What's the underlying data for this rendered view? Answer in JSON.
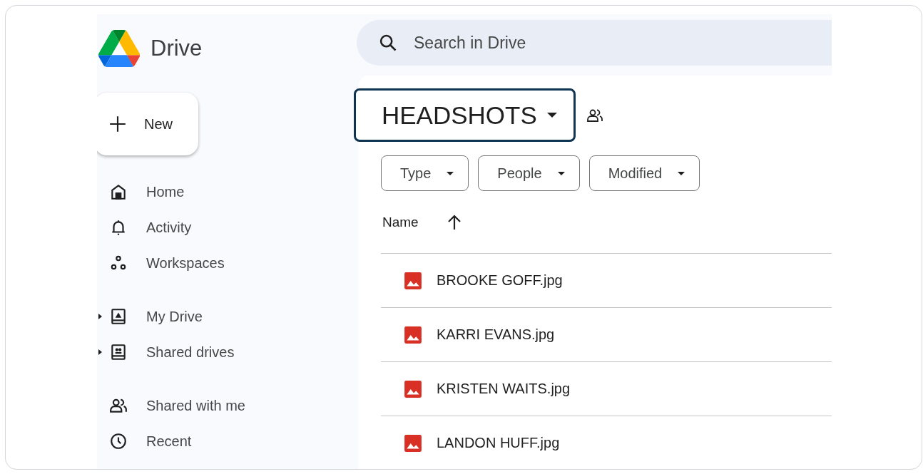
{
  "app": {
    "name": "Drive"
  },
  "search": {
    "placeholder": "Search in Drive"
  },
  "new_button": {
    "label": "New"
  },
  "nav_groups": [
    [
      {
        "label": "Home",
        "kind": "link"
      },
      {
        "label": "Activity",
        "kind": "link"
      },
      {
        "label": "Workspaces",
        "kind": "link"
      }
    ],
    [
      {
        "label": "My Drive",
        "kind": "tree"
      },
      {
        "label": "Shared drives",
        "kind": "tree"
      }
    ],
    [
      {
        "label": "Shared with me",
        "kind": "link"
      },
      {
        "label": "Recent",
        "kind": "link"
      }
    ]
  ],
  "folder": {
    "title": "HEADSHOTS"
  },
  "filters": [
    "Type",
    "People",
    "Modified"
  ],
  "table": {
    "columns": [
      {
        "label": "Name",
        "sort_ascending": true
      }
    ],
    "rows": [
      {
        "name": "BROOKE GOFF.jpg"
      },
      {
        "name": "KARRI EVANS.jpg"
      },
      {
        "name": "KRISTEN WAITS.jpg"
      },
      {
        "name": "LANDON HUFF.jpg"
      }
    ]
  }
}
